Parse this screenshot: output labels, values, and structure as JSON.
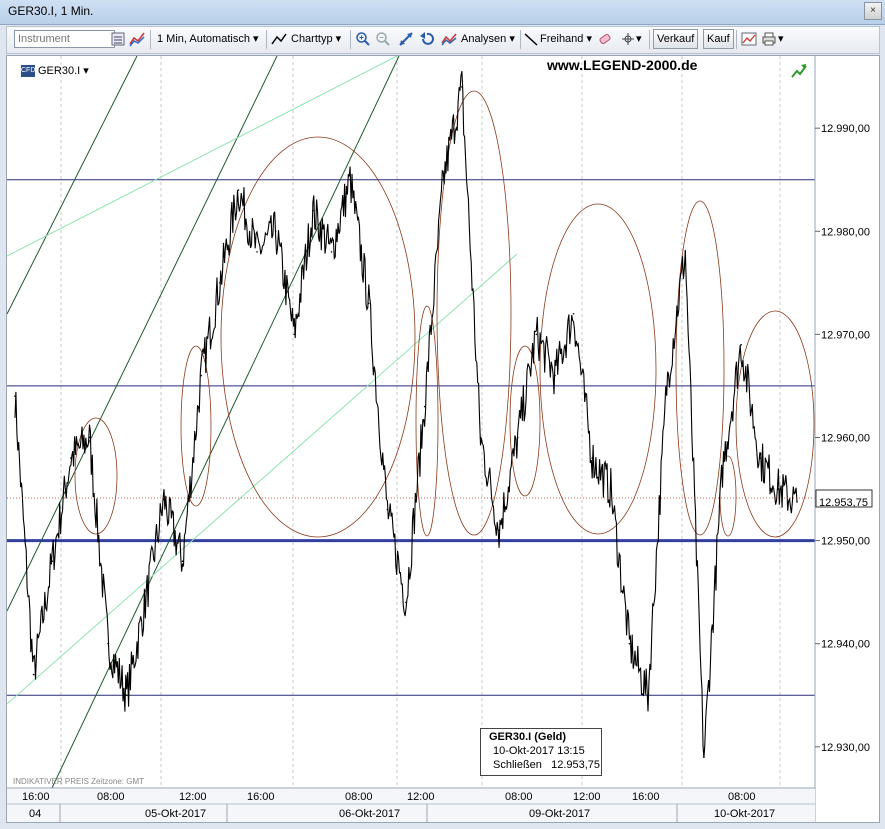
{
  "window": {
    "title": "GER30.I, 1 Min.",
    "close_glyph": "×"
  },
  "toolbar": {
    "instrument_placeholder": "Instrument",
    "interval_label": "1 Min,",
    "mode_label": "Automatisch",
    "charttype_label": "Charttyp",
    "analysen_label": "Analysen",
    "freihand_label": "Freihand",
    "verkauf_label": "Verkauf",
    "kauf_label": "Kauf",
    "dropdown_glyph": "▾"
  },
  "chart_header": {
    "cfd_tag": "CFD",
    "instrument": "GER30.I",
    "dropdown_glyph": "▾",
    "watermark": "www.LEGEND-2000.de"
  },
  "footer": {
    "note": "INDIKATIVER PREIS   Zeitzone: GMT"
  },
  "tooltip": {
    "title": "GER30.I (Geld)",
    "datetime": "10-Okt-2017 13:15",
    "close_label": "Schließen",
    "close_value": "12.953,75"
  },
  "colors": {
    "price_line": "#000000",
    "hline": "#2a2a7a",
    "thick_hline": "#3340a0",
    "ellipse": "#8b3a1a",
    "trend_dark": "#1e5a2e",
    "trend_light": "#8fe3b0",
    "dotted": "#b03020"
  },
  "chart_data": {
    "type": "line",
    "title": "GER30.I, 1 Min.",
    "ylim": [
      12926,
      12997
    ],
    "ytick_values": [
      12930,
      12940,
      12950,
      12960,
      12970,
      12980,
      12990
    ],
    "ytick_labels": [
      "12.930,00",
      "12.940,00",
      "12.950,00",
      "12.960,00",
      "12.970,00",
      "12.980,00",
      "12.990,00"
    ],
    "last_price": 12953.75,
    "last_price_label": "12.953,75",
    "horizontal_levels": [
      12985,
      12965,
      12950,
      12935
    ],
    "xaxis": {
      "time_labels": [
        "16:00",
        "08:00",
        "12:00",
        "16:00",
        "08:00",
        "12:00",
        "08:00",
        "12:00",
        "16:00",
        "08:00"
      ],
      "date_labels": [
        "04",
        "05-Okt-2017",
        "06-Okt-2017",
        "09-Okt-2017",
        "10-Okt-2017"
      ]
    },
    "series": [
      {
        "x": [
          "04-Okt 16:00",
          "04-Okt 17:00",
          "04-Okt 18:00",
          "05-Okt 08:00",
          "05-Okt 09:00",
          "05-Okt 10:00",
          "05-Okt 11:00",
          "05-Okt 12:00",
          "05-Okt 13:00",
          "05-Okt 14:00",
          "05-Okt 15:00",
          "05-Okt 16:00",
          "05-Okt 17:00",
          "05-Okt 18:00",
          "06-Okt 08:00",
          "06-Okt 09:00",
          "06-Okt 10:00",
          "06-Okt 11:00",
          "06-Okt 12:00",
          "06-Okt 13:00",
          "06-Okt 14:00",
          "06-Okt 15:00",
          "06-Okt 16:00",
          "06-Okt 17:00",
          "06-Okt 18:00",
          "09-Okt 08:00",
          "09-Okt 09:00",
          "09-Okt 10:00",
          "09-Okt 11:00",
          "09-Okt 12:00",
          "09-Okt 13:00",
          "09-Okt 14:00",
          "09-Okt 15:00",
          "09-Okt 16:00",
          "09-Okt 17:00",
          "09-Okt 18:00",
          "10-Okt 07:00",
          "10-Okt 08:00",
          "10-Okt 09:00",
          "10-Okt 10:00",
          "10-Okt 11:00",
          "10-Okt 12:00",
          "10-Okt 13:00"
        ],
        "values": [
          12964,
          12937,
          12948,
          12958,
          12960,
          12940,
          12935,
          12944,
          12954,
          12948,
          12966,
          12975,
          12984,
          12978,
          12980,
          12970,
          12982,
          12978,
          12985,
          12973,
          12953,
          12944,
          12963,
          12985,
          12994,
          12960,
          12951,
          12960,
          12970,
          12966,
          12972,
          12958,
          12955,
          12940,
          12935,
          12965,
          12978,
          12929,
          12957,
          12969,
          12958,
          12955,
          12953.75
        ]
      }
    ]
  }
}
